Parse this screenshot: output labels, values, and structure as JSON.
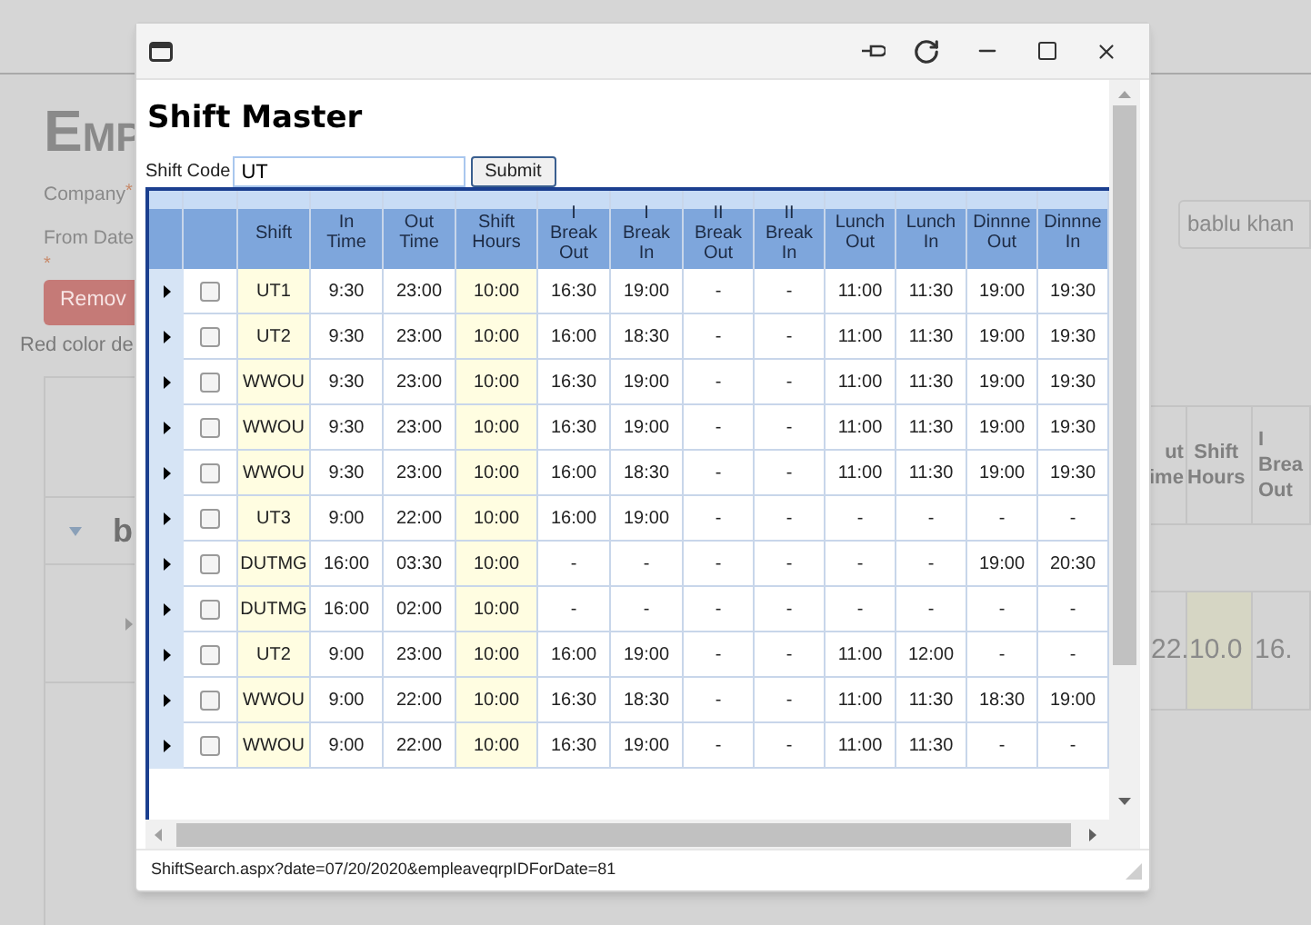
{
  "background_page": {
    "heading": "EMP",
    "fields": [
      {
        "label": "Company",
        "required_mark": "*"
      },
      {
        "label": "From Date",
        "required_mark": "*"
      }
    ],
    "remove_button": "Remov",
    "note": "Red color de",
    "search_value": "bablu khan",
    "group_row": {
      "expanded": true,
      "label": "b"
    },
    "table_columns": [
      {
        "label": "ut ime",
        "highlighted": false
      },
      {
        "label": "Shift Hours",
        "highlighted": false
      },
      {
        "label": "I Brea Out",
        "highlighted": false
      }
    ],
    "row": {
      "expanded": false,
      "cells": [
        {
          "text": "22.",
          "highlighted": false
        },
        {
          "text": "10.0",
          "highlighted": true
        },
        {
          "text": "16.",
          "highlighted": false
        }
      ]
    }
  },
  "popup": {
    "title": "Shift Master",
    "search": {
      "label": "Shift Code",
      "value": "UT",
      "button": "Submit"
    },
    "columns": [
      {
        "label": "Shift",
        "highlighted": true
      },
      {
        "label": "In Time",
        "highlighted": false
      },
      {
        "label": "Out Time",
        "highlighted": false
      },
      {
        "label": "Shift Hours",
        "highlighted": true
      },
      {
        "label": "I Break Out",
        "highlighted": false
      },
      {
        "label": "I Break In",
        "highlighted": false
      },
      {
        "label": "II Break Out",
        "highlighted": false
      },
      {
        "label": "II Break In",
        "highlighted": false
      },
      {
        "label": "Lunch Out",
        "highlighted": false
      },
      {
        "label": "Lunch In",
        "highlighted": false
      },
      {
        "label": "Dinnne Out",
        "highlighted": false
      },
      {
        "label": "Dinnne In",
        "highlighted": false
      }
    ],
    "rows": [
      {
        "expanded": false,
        "checked": false,
        "cells": [
          "UT1",
          "9:30",
          "23:00",
          "10:00",
          "16:30",
          "19:00",
          "-",
          "-",
          "11:00",
          "11:30",
          "19:00",
          "19:30"
        ]
      },
      {
        "expanded": false,
        "checked": false,
        "cells": [
          "UT2",
          "9:30",
          "23:00",
          "10:00",
          "16:00",
          "18:30",
          "-",
          "-",
          "11:00",
          "11:30",
          "19:00",
          "19:30"
        ]
      },
      {
        "expanded": false,
        "checked": false,
        "cells": [
          "WWOU",
          "9:30",
          "23:00",
          "10:00",
          "16:30",
          "19:00",
          "-",
          "-",
          "11:00",
          "11:30",
          "19:00",
          "19:30"
        ]
      },
      {
        "expanded": false,
        "checked": false,
        "cells": [
          "WWOU",
          "9:30",
          "23:00",
          "10:00",
          "16:30",
          "19:00",
          "-",
          "-",
          "11:00",
          "11:30",
          "19:00",
          "19:30"
        ]
      },
      {
        "expanded": false,
        "checked": false,
        "cells": [
          "WWOU",
          "9:30",
          "23:00",
          "10:00",
          "16:00",
          "18:30",
          "-",
          "-",
          "11:00",
          "11:30",
          "19:00",
          "19:30"
        ]
      },
      {
        "expanded": false,
        "checked": false,
        "cells": [
          "UT3",
          "9:00",
          "22:00",
          "10:00",
          "16:00",
          "19:00",
          "-",
          "-",
          "-",
          "-",
          "-",
          "-"
        ]
      },
      {
        "expanded": false,
        "checked": false,
        "cells": [
          "DUTMG",
          "16:00",
          "03:30",
          "10:00",
          "-",
          "-",
          "-",
          "-",
          "-",
          "-",
          "19:00",
          "20:30"
        ]
      },
      {
        "expanded": false,
        "checked": false,
        "cells": [
          "DUTMG",
          "16:00",
          "02:00",
          "10:00",
          "-",
          "-",
          "-",
          "-",
          "-",
          "-",
          "-",
          "-"
        ]
      },
      {
        "expanded": false,
        "checked": false,
        "cells": [
          "UT2",
          "9:00",
          "23:00",
          "10:00",
          "16:00",
          "19:00",
          "-",
          "-",
          "11:00",
          "12:00",
          "-",
          "-"
        ]
      },
      {
        "expanded": false,
        "checked": false,
        "cells": [
          "WWOU",
          "9:00",
          "22:00",
          "10:00",
          "16:30",
          "18:30",
          "-",
          "-",
          "11:00",
          "11:30",
          "18:30",
          "19:00"
        ]
      },
      {
        "expanded": false,
        "checked": false,
        "cells": [
          "WWOU",
          "9:00",
          "22:00",
          "10:00",
          "16:30",
          "19:00",
          "-",
          "-",
          "11:00",
          "11:30",
          "-",
          "-"
        ]
      }
    ],
    "status_url": "ShiftSearch.aspx?date=07/20/2020&empleaveqrpIDForDate=81"
  }
}
